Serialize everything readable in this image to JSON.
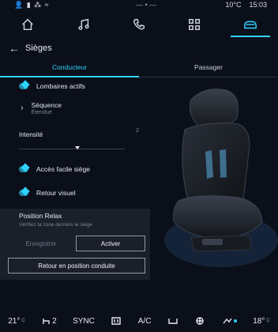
{
  "status": {
    "icons_left": "👤 ▮ ⁂ ≈",
    "center": "— • —",
    "temp": "10°C",
    "time": "15:03"
  },
  "nav": {
    "tabs": [
      {
        "icon": "home-icon"
      },
      {
        "icon": "music-icon"
      },
      {
        "icon": "phone-icon"
      },
      {
        "icon": "apps-icon"
      },
      {
        "icon": "car-seat-icon"
      }
    ],
    "active_index": 4
  },
  "header": {
    "title": "Sièges"
  },
  "subtabs": [
    "Conducteur",
    "Passager"
  ],
  "settings": {
    "lumbar": "Lombaires actifs",
    "sequence_label": "Séquence",
    "sequence_value": "Étendue",
    "intensity_label": "Intensité",
    "intensity_value": "2",
    "intensity_level": 0.55,
    "easy_access": "Accès facile siège",
    "visual_feedback": "Retour visuel"
  },
  "relax": {
    "title": "Position Relax",
    "hint": "Vérifiez la zone derrière le siège",
    "save": "Enregistrer",
    "activate": "Activer",
    "return_driving": "Retour en position conduite"
  },
  "climate": {
    "left_temp": "21°",
    "seat_level": "2",
    "sync": "SYNC",
    "ac": "A/C",
    "right_temp": "18°"
  },
  "colors": {
    "accent": "#2fd3ff",
    "background": "#0b0f19"
  }
}
